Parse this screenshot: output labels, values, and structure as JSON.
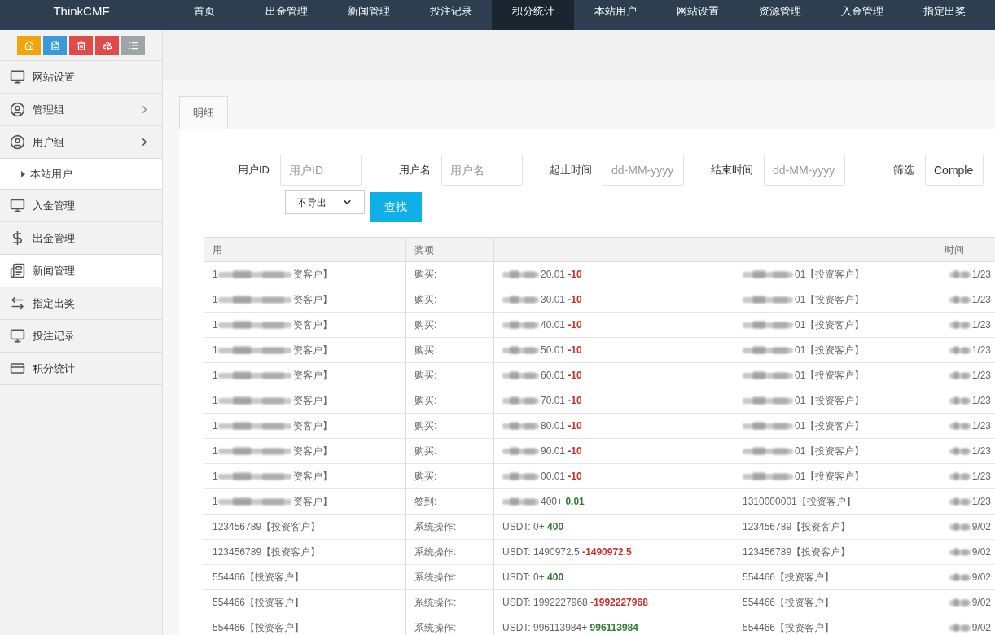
{
  "brand": "ThinkCMF",
  "nav": [
    {
      "label": "首页",
      "selected": false
    },
    {
      "label": "出金管理",
      "selected": false
    },
    {
      "label": "新闻管理",
      "selected": false
    },
    {
      "label": "投注记录",
      "selected": false
    },
    {
      "label": "积分统计",
      "selected": true
    },
    {
      "label": "本站用户",
      "selected": false
    },
    {
      "label": "网站设置",
      "selected": false
    },
    {
      "label": "资源管理",
      "selected": false
    },
    {
      "label": "入金管理",
      "selected": false
    },
    {
      "label": "指定出奖",
      "selected": false
    }
  ],
  "toolbar": [
    {
      "kind": "home",
      "color": "#f0a30a"
    },
    {
      "kind": "file",
      "color": "#3a9ad9"
    },
    {
      "kind": "trash",
      "color": "#e04b4a"
    },
    {
      "kind": "recycle",
      "color": "#e04b4a"
    },
    {
      "kind": "list",
      "color": "#9da5a8"
    }
  ],
  "sidebar": {
    "items": [
      {
        "label": "网站设置",
        "kind": "monitor",
        "selected": false
      },
      {
        "label": "管理组",
        "kind": "user-circle",
        "selected": false,
        "expanded": false
      },
      {
        "label": "用户组",
        "kind": "user",
        "selected": false,
        "expanded": true,
        "children": [
          {
            "label": "本站用户"
          }
        ]
      },
      {
        "label": "入金管理",
        "kind": "monitor",
        "selected": false
      },
      {
        "label": "出金管理",
        "kind": "dollar",
        "selected": false
      },
      {
        "label": "新闻管理",
        "kind": "news",
        "selected": true
      },
      {
        "label": "指定出奖",
        "kind": "exchange",
        "selected": false
      },
      {
        "label": "投注记录",
        "kind": "monitor",
        "selected": false
      },
      {
        "label": "积分统计",
        "kind": "card",
        "selected": false
      }
    ]
  },
  "tabs": [
    {
      "label": "明细",
      "selected": true
    }
  ],
  "filters": [
    {
      "label": "用户ID",
      "placeholder": "用户ID"
    },
    {
      "label": "用户名",
      "placeholder": "用户名"
    },
    {
      "label": "起止时间",
      "placeholder": "dd-MM-yyyy"
    },
    {
      "label": "结束时间",
      "placeholder": "dd-MM-yyyy"
    },
    {
      "label": "筛选",
      "value": "Comple"
    }
  ],
  "export_select": {
    "value": "不导出"
  },
  "search_button": "查找",
  "table": {
    "columns": [
      "用",
      "奖项",
      "",
      "",
      "时间"
    ],
    "rows": [
      {
        "user": {
          "lead": "1",
          "text": "资客户】",
          "redacted": true
        },
        "item": "购买:",
        "amount": {
          "text": "20.01 ",
          "delta": "-10",
          "kind": "decrease",
          "redacted": true
        },
        "target": {
          "text": "01【投资客户】",
          "redacted": true
        },
        "time": {
          "text": "1/23",
          "redacted": true
        }
      },
      {
        "user": {
          "lead": "1",
          "text": "资客户】",
          "redacted": true
        },
        "item": "购买:",
        "amount": {
          "text": "30.01 ",
          "delta": "-10",
          "kind": "decrease",
          "redacted": true
        },
        "target": {
          "text": "01【投资客户】",
          "redacted": true
        },
        "time": {
          "text": "1/23",
          "redacted": true
        }
      },
      {
        "user": {
          "lead": "1",
          "text": "资客户】",
          "redacted": true
        },
        "item": "购买:",
        "amount": {
          "text": "40.01 ",
          "delta": "-10",
          "kind": "decrease",
          "redacted": true
        },
        "target": {
          "text": "01【投资客户】",
          "redacted": true
        },
        "time": {
          "text": "1/23",
          "redacted": true
        }
      },
      {
        "user": {
          "lead": "1",
          "text": "资客户】",
          "redacted": true
        },
        "item": "购买:",
        "amount": {
          "text": "50.01 ",
          "delta": "-10",
          "kind": "decrease",
          "redacted": true
        },
        "target": {
          "text": "01【投资客户】",
          "redacted": true
        },
        "time": {
          "text": "1/23",
          "redacted": true
        }
      },
      {
        "user": {
          "lead": "1",
          "text": "资客户】",
          "redacted": true
        },
        "item": "购买:",
        "amount": {
          "text": "60.01 ",
          "delta": "-10",
          "kind": "decrease",
          "redacted": true
        },
        "target": {
          "text": "01【投资客户】",
          "redacted": true
        },
        "time": {
          "text": "1/23",
          "redacted": true
        }
      },
      {
        "user": {
          "lead": "1",
          "text": "资客户】",
          "redacted": true
        },
        "item": "购买:",
        "amount": {
          "text": "70.01 ",
          "delta": "-10",
          "kind": "decrease",
          "redacted": true
        },
        "target": {
          "text": "01【投资客户】",
          "redacted": true
        },
        "time": {
          "text": "1/23",
          "redacted": true
        }
      },
      {
        "user": {
          "lead": "1",
          "text": "资客户】",
          "redacted": true
        },
        "item": "购买:",
        "amount": {
          "text": "80.01 ",
          "delta": "-10",
          "kind": "decrease",
          "redacted": true
        },
        "target": {
          "text": "01【投资客户】",
          "redacted": true
        },
        "time": {
          "text": "1/23",
          "redacted": true
        }
      },
      {
        "user": {
          "lead": "1",
          "text": "资客户】",
          "redacted": true
        },
        "item": "购买:",
        "amount": {
          "text": "90.01 ",
          "delta": "-10",
          "kind": "decrease",
          "redacted": true
        },
        "target": {
          "text": "01【投资客户】",
          "redacted": true
        },
        "time": {
          "text": "1/23",
          "redacted": true
        }
      },
      {
        "user": {
          "lead": "1",
          "text": "资客户】",
          "redacted": true
        },
        "item": "购买:",
        "amount": {
          "text": "00.01 ",
          "delta": "-10",
          "kind": "decrease",
          "redacted": true
        },
        "target": {
          "text": "01【投资客户】",
          "redacted": true
        },
        "time": {
          "text": "1/23",
          "redacted": true
        }
      },
      {
        "user": {
          "lead": "1",
          "text": "资客户】",
          "redacted": true
        },
        "item": "签到:",
        "amount": {
          "text": "400+ ",
          "delta": "0.01",
          "kind": "increase",
          "redacted": true
        },
        "target": {
          "text": "1310000001【投资客户】",
          "redacted": false
        },
        "time": {
          "text": "1/23",
          "redacted": true
        }
      },
      {
        "user": {
          "text": "123456789【投资客户】",
          "redacted": false
        },
        "item": "系统操作:",
        "amount": {
          "text": "USDT: 0+ ",
          "delta": "400",
          "kind": "increase",
          "redacted": false
        },
        "target": {
          "text": "123456789【投资客户】",
          "redacted": false
        },
        "time": {
          "text": "9/02",
          "redacted": true
        }
      },
      {
        "user": {
          "text": "123456789【投资客户】",
          "redacted": false
        },
        "item": "系统操作:",
        "amount": {
          "text": "USDT: 1490972.5 ",
          "delta": "-1490972.5",
          "kind": "decrease",
          "redacted": false
        },
        "target": {
          "text": "123456789【投资客户】",
          "redacted": false
        },
        "time": {
          "text": "9/02",
          "redacted": true
        }
      },
      {
        "user": {
          "text": "554466【投资客户】",
          "redacted": false
        },
        "item": "系统操作:",
        "amount": {
          "text": "USDT: 0+ ",
          "delta": "400",
          "kind": "increase",
          "redacted": false
        },
        "target": {
          "text": "554466【投资客户】",
          "redacted": false
        },
        "time": {
          "text": "9/02",
          "redacted": true
        }
      },
      {
        "user": {
          "text": "554466【投资客户】",
          "redacted": false
        },
        "item": "系统操作:",
        "amount": {
          "text": "USDT: 1992227968 ",
          "delta": "-1992227968",
          "kind": "decrease",
          "redacted": false
        },
        "target": {
          "text": "554466【投资客户】",
          "redacted": false
        },
        "time": {
          "text": "9/02",
          "redacted": true
        }
      },
      {
        "user": {
          "text": "554466【投资客户】",
          "redacted": false
        },
        "item": "系统操作:",
        "amount": {
          "text": "USDT: 996113984+ ",
          "delta": "996113984",
          "kind": "increase",
          "redacted": false
        },
        "target": {
          "text": "554466【投资客户】",
          "redacted": false
        },
        "time": {
          "text": "9/02",
          "redacted": true
        }
      }
    ]
  }
}
